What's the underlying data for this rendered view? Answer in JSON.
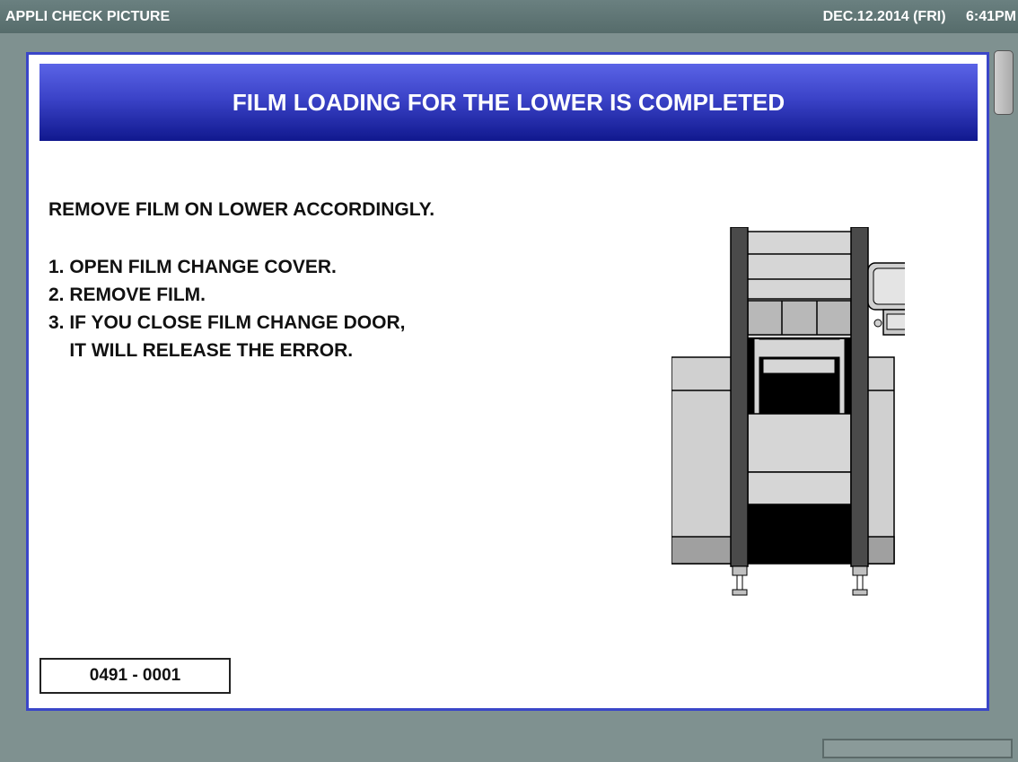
{
  "titlebar": {
    "app_title": "APPLI CHECK PICTURE",
    "date": "DEC.12.2014 (FRI)",
    "time": "6:41PM"
  },
  "dialog": {
    "title": "FILM LOADING FOR THE LOWER IS COMPLETED",
    "heading": "REMOVE FILM ON LOWER ACCORDINGLY.",
    "steps": [
      "1. OPEN FILM CHANGE COVER.",
      "2. REMOVE FILM.",
      "3. IF YOU CLOSE FILM CHANGE DOOR,",
      "    IT WILL RELEASE THE ERROR."
    ],
    "error_code": "0491 - 0001"
  },
  "colors": {
    "background": "#7f9190",
    "panel_border": "#3a46c8",
    "header_top": "#5a63e6",
    "header_bottom": "#10188e"
  },
  "icons": {
    "machine_illustration": "machine-illustration-icon"
  }
}
